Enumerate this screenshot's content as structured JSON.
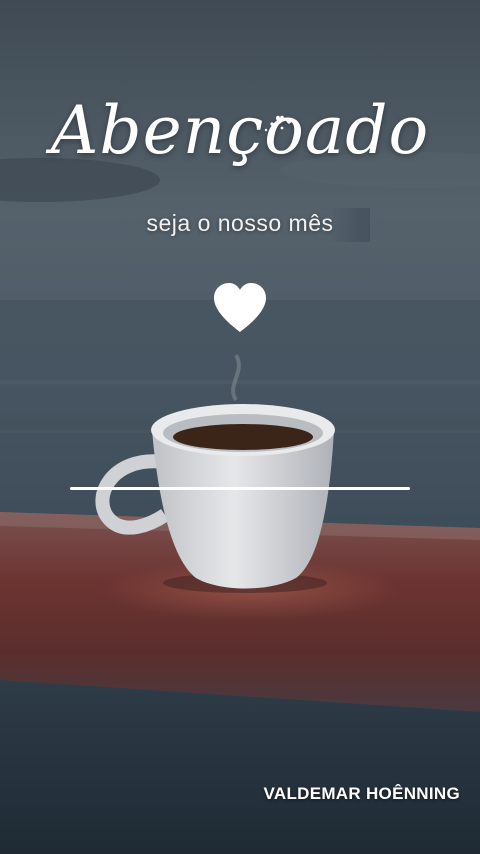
{
  "title": "Abençoado",
  "subtitle": "seja o nosso mês",
  "signature": "VALDEMAR HOÊNNING",
  "icons": {
    "heart": "heart-icon",
    "sparkles": "sparkle-hearts-icon"
  },
  "colors": {
    "sky": "#4a5661",
    "sea": "#3a4853",
    "table_wood": "#6b3a36",
    "cup": "#d9dadc",
    "text": "#ffffff"
  }
}
